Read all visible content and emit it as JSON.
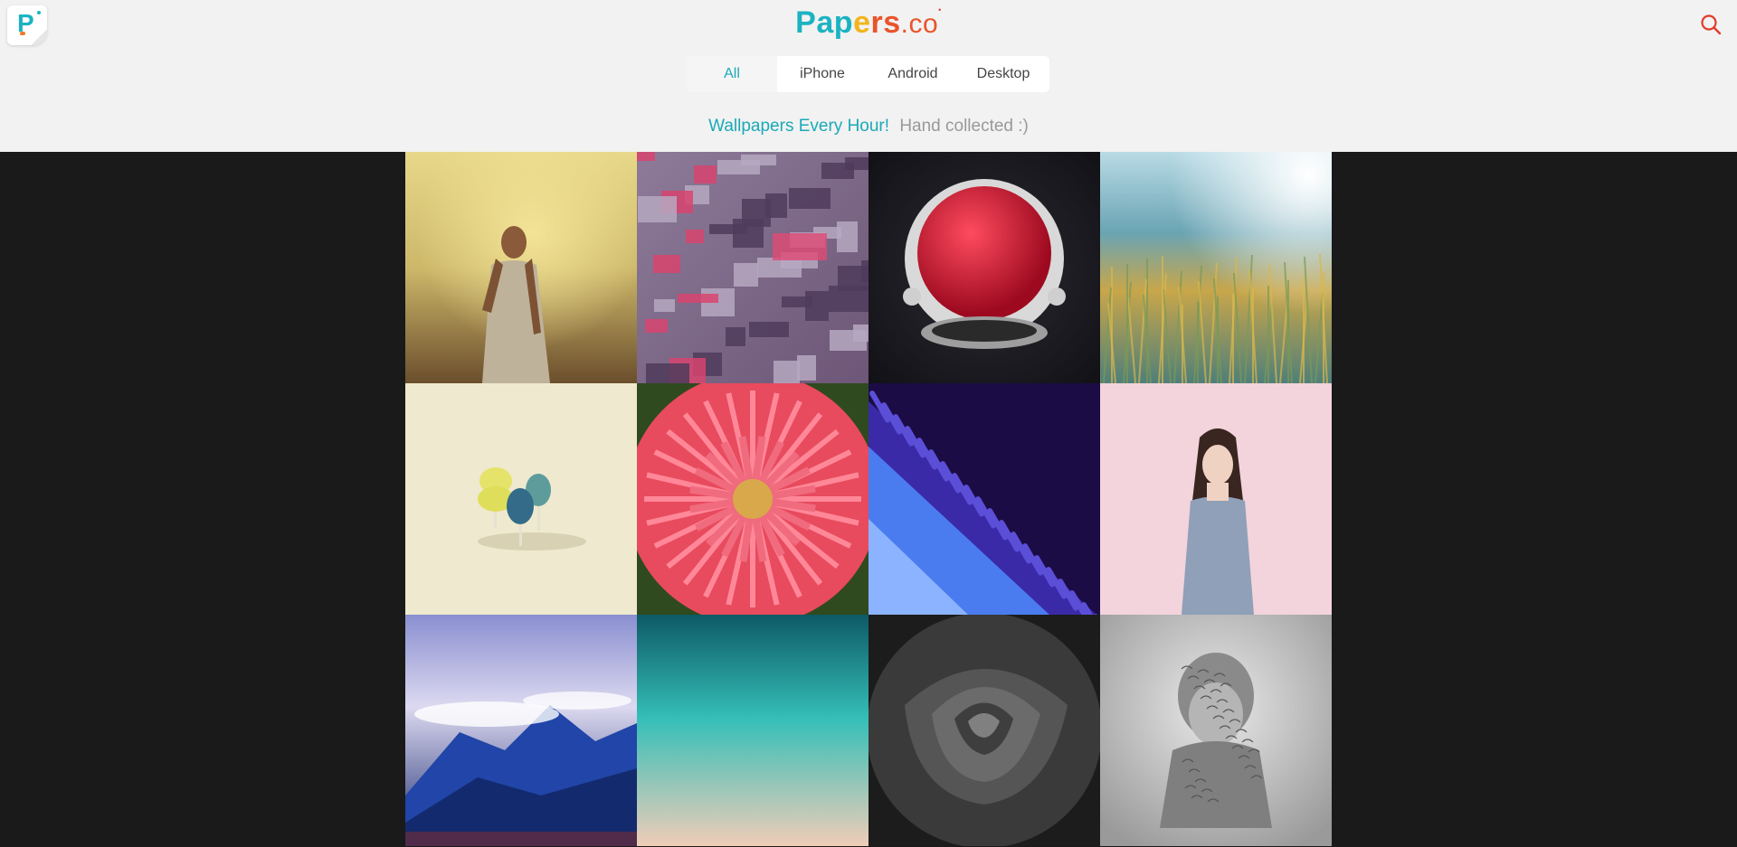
{
  "brand": {
    "letters": [
      {
        "ch": "P",
        "color": "#1bb3c2"
      },
      {
        "ch": "a",
        "color": "#1bb3c2"
      },
      {
        "ch": "p",
        "color": "#1bb3c2"
      },
      {
        "ch": "e",
        "color": "#f2b51d"
      },
      {
        "ch": "r",
        "color": "#e9542a"
      },
      {
        "ch": "s",
        "color": "#e9542a"
      }
    ],
    "suffix": ".co",
    "suffix_color": "#e9542a"
  },
  "logo_badge": {
    "icon": "papers-p-logo-icon"
  },
  "search": {
    "icon": "search-icon",
    "color": "#e23b2a"
  },
  "tabs": [
    {
      "label": "All",
      "active": true
    },
    {
      "label": "iPhone",
      "active": false
    },
    {
      "label": "Android",
      "active": false
    },
    {
      "label": "Desktop",
      "active": false
    }
  ],
  "tagline": {
    "highlight": "Wallpapers Every Hour!",
    "sub": "Hand collected :)"
  },
  "colors": {
    "accent": "#1aa9b8",
    "header_bg": "#f2f2f2",
    "page_bg": "#1a1a1a"
  },
  "wallpapers": [
    {
      "subject": "woman-yellow-light"
    },
    {
      "subject": "abstract-purple-city"
    },
    {
      "subject": "red-astronaut-helmet"
    },
    {
      "subject": "sunny-grass-field"
    },
    {
      "subject": "toy-trees-cream"
    },
    {
      "subject": "pink-dahlia-flower"
    },
    {
      "subject": "blue-purple-abstract-waves"
    },
    {
      "subject": "girl-pink-background"
    },
    {
      "subject": "blue-mountains-clouds"
    },
    {
      "subject": "teal-gradient"
    },
    {
      "subject": "black-white-rose"
    },
    {
      "subject": "sculpture-bust-gray"
    }
  ]
}
